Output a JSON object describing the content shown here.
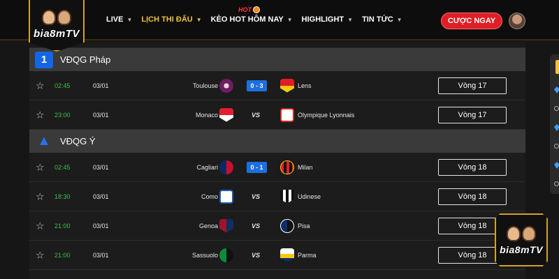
{
  "brand": {
    "logo_text": "bia8mTV"
  },
  "nav": {
    "items": [
      {
        "label": "LIVE",
        "active": false
      },
      {
        "label": "LỊCH THI ĐẤU",
        "active": true
      },
      {
        "label": "KÈO HOT HÔM NAY",
        "active": false
      },
      {
        "label": "HIGHLIGHT",
        "active": false
      },
      {
        "label": "TIN TỨC",
        "active": false
      }
    ],
    "hot_badge": "HOT",
    "cta_label": "CƯỢC NGAY"
  },
  "leagues": [
    {
      "name": "VĐQG Pháp",
      "icon": "ligue1-logo-icon",
      "matches": [
        {
          "time": "02:45",
          "date": "03/01",
          "home": "Toulouse",
          "score": "0 - 3",
          "away": "Lens",
          "round": "Vòng 17"
        },
        {
          "time": "23:00",
          "date": "03/01",
          "home": "Monaco",
          "score": "VS",
          "away": "Olympique Lyonnais",
          "round": "Vòng 17"
        }
      ]
    },
    {
      "name": "VĐQG Ý",
      "icon": "serie-a-logo-icon",
      "matches": [
        {
          "time": "02:45",
          "date": "03/01",
          "home": "Cagliari",
          "score": "0 - 1",
          "away": "Milan",
          "round": "Vòng 18"
        },
        {
          "time": "18:30",
          "date": "03/01",
          "home": "Como",
          "score": "VS",
          "away": "Udinese",
          "round": "Vòng 18"
        },
        {
          "time": "21:00",
          "date": "03/01",
          "home": "Genoa",
          "score": "VS",
          "away": "Pisa",
          "round": "Vòng 18"
        },
        {
          "time": "21:00",
          "date": "03/01",
          "home": "Sassuolo",
          "score": "VS",
          "away": "Parma",
          "round": "Vòng 18"
        }
      ]
    }
  ],
  "colors": {
    "accent_gold": "#f0c040",
    "cta_red": "#e01e26",
    "score_blue": "#1d6fe0",
    "time_green": "#3fbf4a"
  }
}
